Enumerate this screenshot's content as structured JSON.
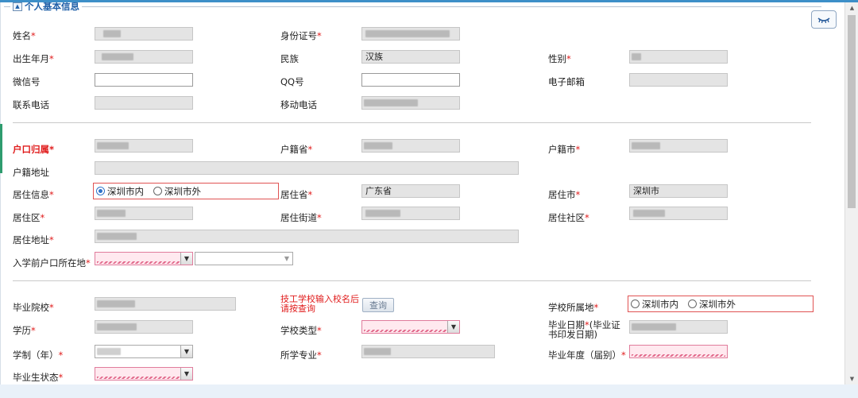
{
  "section": {
    "title": "个人基本信息"
  },
  "labels": {
    "name": "姓名",
    "id_no": "身份证号",
    "birth": "出生年月",
    "ethnic": "民族",
    "gender": "性别",
    "wechat": "微信号",
    "qq": "QQ号",
    "email": "电子邮箱",
    "phone": "联系电话",
    "mobile": "移动电话",
    "hukou": "户口归属",
    "hukou_prov": "户籍省",
    "hukou_city": "户籍市",
    "hukou_addr": "户籍地址",
    "residence": "居住信息",
    "res_prov": "居住省",
    "res_city": "居住市",
    "res_district": "居住区",
    "res_street": "居住街道",
    "res_community": "居住社区",
    "res_addr": "居住地址",
    "pre_hukou": "入学前户口所在地",
    "grad_school": "毕业院校",
    "school_loc": "学校所属地",
    "education": "学历",
    "school_type": "学校类型",
    "grad_date": "毕业日期",
    "grad_date_note": "(毕业证书印发日期)",
    "duration": "学制（年）",
    "major": "所学专业",
    "grad_year": "毕业年度（届别）",
    "grad_status": "毕业生状态"
  },
  "values": {
    "ethnic": "汉族",
    "res_prov": "广东省",
    "res_city": "深圳市"
  },
  "radios": {
    "residence": {
      "options": [
        "深圳市内",
        "深圳市外"
      ],
      "selected": "深圳市内"
    },
    "school_loc": {
      "options": [
        "深圳市内",
        "深圳市外"
      ],
      "selected": ""
    }
  },
  "hint": "技工学校输入校名后请按查询",
  "query_button": "查询",
  "required_mark": "*",
  "icons": {
    "collapse": "triangle-up-icon",
    "eye": "eye-closed-icon",
    "scroll_up": "arrow-up-icon",
    "scroll_down": "arrow-down-icon"
  }
}
